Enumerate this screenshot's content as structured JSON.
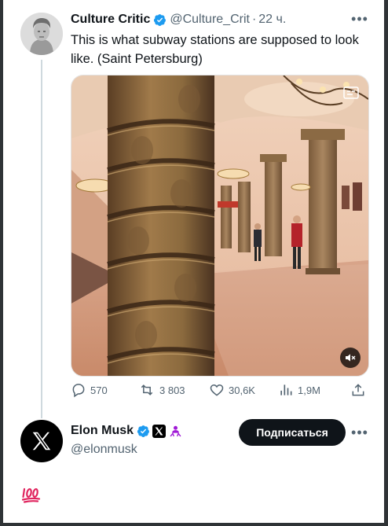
{
  "tweet": {
    "author_name": "Culture Critic",
    "author_handle": "@Culture_Crit",
    "separator": "·",
    "time": "22 ч.",
    "text": "This is what subway stations are supposed to look like. (Saint Petersburg)",
    "media": {
      "type": "video",
      "muted": true
    }
  },
  "actions": {
    "replies": "570",
    "retweets": "3 803",
    "likes": "30,6K",
    "views": "1,9M"
  },
  "reply": {
    "author_name": "Elon Musk",
    "author_handle": "@elonmusk",
    "follow_label": "Подписаться",
    "content_emoji": "💯"
  },
  "colors": {
    "verified_blue": "#1d9bf0",
    "text_primary": "#0f1419",
    "text_secondary": "#536471",
    "follow_button": "#0f1419",
    "emoji_red": "#e0245e"
  },
  "icons": [
    "more-icon",
    "verified-badge-icon",
    "captions-icon",
    "mute-icon",
    "reply-icon",
    "retweet-icon",
    "like-icon",
    "views-icon",
    "share-icon",
    "x-logo-icon",
    "affiliate-badge-icon",
    "hundred-points-icon"
  ]
}
